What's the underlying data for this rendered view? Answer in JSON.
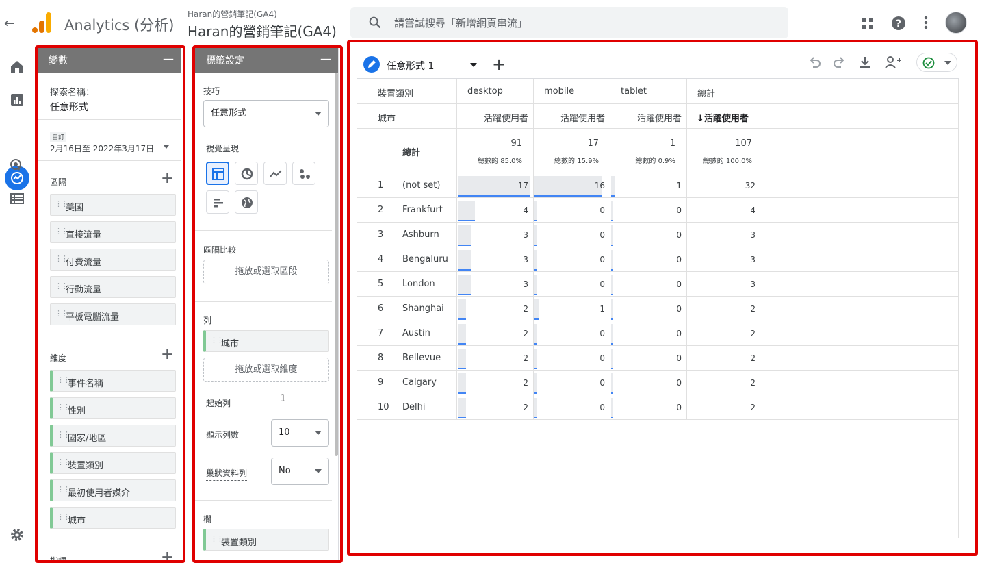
{
  "header": {
    "app_title": "Analytics (分析)",
    "property_small": "Haran的營銷筆記(GA4)",
    "property_large": "Haran的營銷筆記(GA4)",
    "search_placeholder": "請嘗試搜尋「新增網頁串流」"
  },
  "variables_panel": {
    "title": "變數",
    "exploration_name_label": "探索名稱：",
    "exploration_name": "任意形式",
    "date_badge": "自訂",
    "date_range": "2月16日至 2022年3月17日",
    "segments_label": "區隔",
    "segments": [
      "美國",
      "直接流量",
      "付費流量",
      "行動流量",
      "平板電腦流量"
    ],
    "dimensions_label": "維度",
    "dimensions": [
      "事件名稱",
      "性別",
      "國家/地區",
      "裝置類別",
      "最初使用者媒介",
      "城市"
    ],
    "metrics_label": "指標"
  },
  "tab_settings_panel": {
    "title": "標籤設定",
    "technique_label": "技巧",
    "technique_value": "任意形式",
    "visualization_label": "視覺呈現",
    "segment_comparison_label": "區隔比較",
    "drop_segment": "拖放或選取區段",
    "rows_label": "列",
    "row_chip": "城市",
    "drop_dimension": "拖放或選取維度",
    "start_row_label": "起始列",
    "start_row_value": "1",
    "show_rows_label": "顯示列數",
    "show_rows_value": "10",
    "nested_rows_label": "巢狀資料列",
    "nested_rows_value": "No",
    "columns_label": "欄",
    "column_chip": "裝置類別"
  },
  "canvas": {
    "tab_name": "任意形式 1",
    "table": {
      "col_dim_label": "裝置類別",
      "row_dim_label": "城市",
      "columns": [
        "desktop",
        "mobile",
        "tablet",
        "總計"
      ],
      "metric_label": "活躍使用者",
      "total_metric_label": "↓活躍使用者",
      "totals_label": "總計",
      "totals": [
        {
          "value": "91",
          "pct": "總數的 85.0%"
        },
        {
          "value": "17",
          "pct": "總數的 15.9%"
        },
        {
          "value": "1",
          "pct": "總數的 0.9%"
        },
        {
          "value": "107",
          "pct": "總數的 100.0%"
        }
      ],
      "rows": [
        {
          "rank": "1",
          "city": "(not set)",
          "values": [
            "17",
            "16",
            "1",
            "32"
          ]
        },
        {
          "rank": "2",
          "city": "Frankfurt",
          "values": [
            "4",
            "0",
            "0",
            "4"
          ]
        },
        {
          "rank": "3",
          "city": "Ashburn",
          "values": [
            "3",
            "0",
            "0",
            "3"
          ]
        },
        {
          "rank": "4",
          "city": "Bengaluru",
          "values": [
            "3",
            "0",
            "0",
            "3"
          ]
        },
        {
          "rank": "5",
          "city": "London",
          "values": [
            "3",
            "0",
            "0",
            "3"
          ]
        },
        {
          "rank": "6",
          "city": "Shanghai",
          "values": [
            "2",
            "1",
            "0",
            "2"
          ]
        },
        {
          "rank": "7",
          "city": "Austin",
          "values": [
            "2",
            "0",
            "0",
            "2"
          ]
        },
        {
          "rank": "8",
          "city": "Bellevue",
          "values": [
            "2",
            "0",
            "0",
            "2"
          ]
        },
        {
          "rank": "9",
          "city": "Calgary",
          "values": [
            "2",
            "0",
            "0",
            "2"
          ]
        },
        {
          "rank": "10",
          "city": "Delhi",
          "values": [
            "2",
            "0",
            "0",
            "2"
          ]
        }
      ]
    }
  },
  "colors": {
    "accent": "#1a73e8",
    "highlight": "#e00000",
    "dimension_chip": "#81c995"
  }
}
